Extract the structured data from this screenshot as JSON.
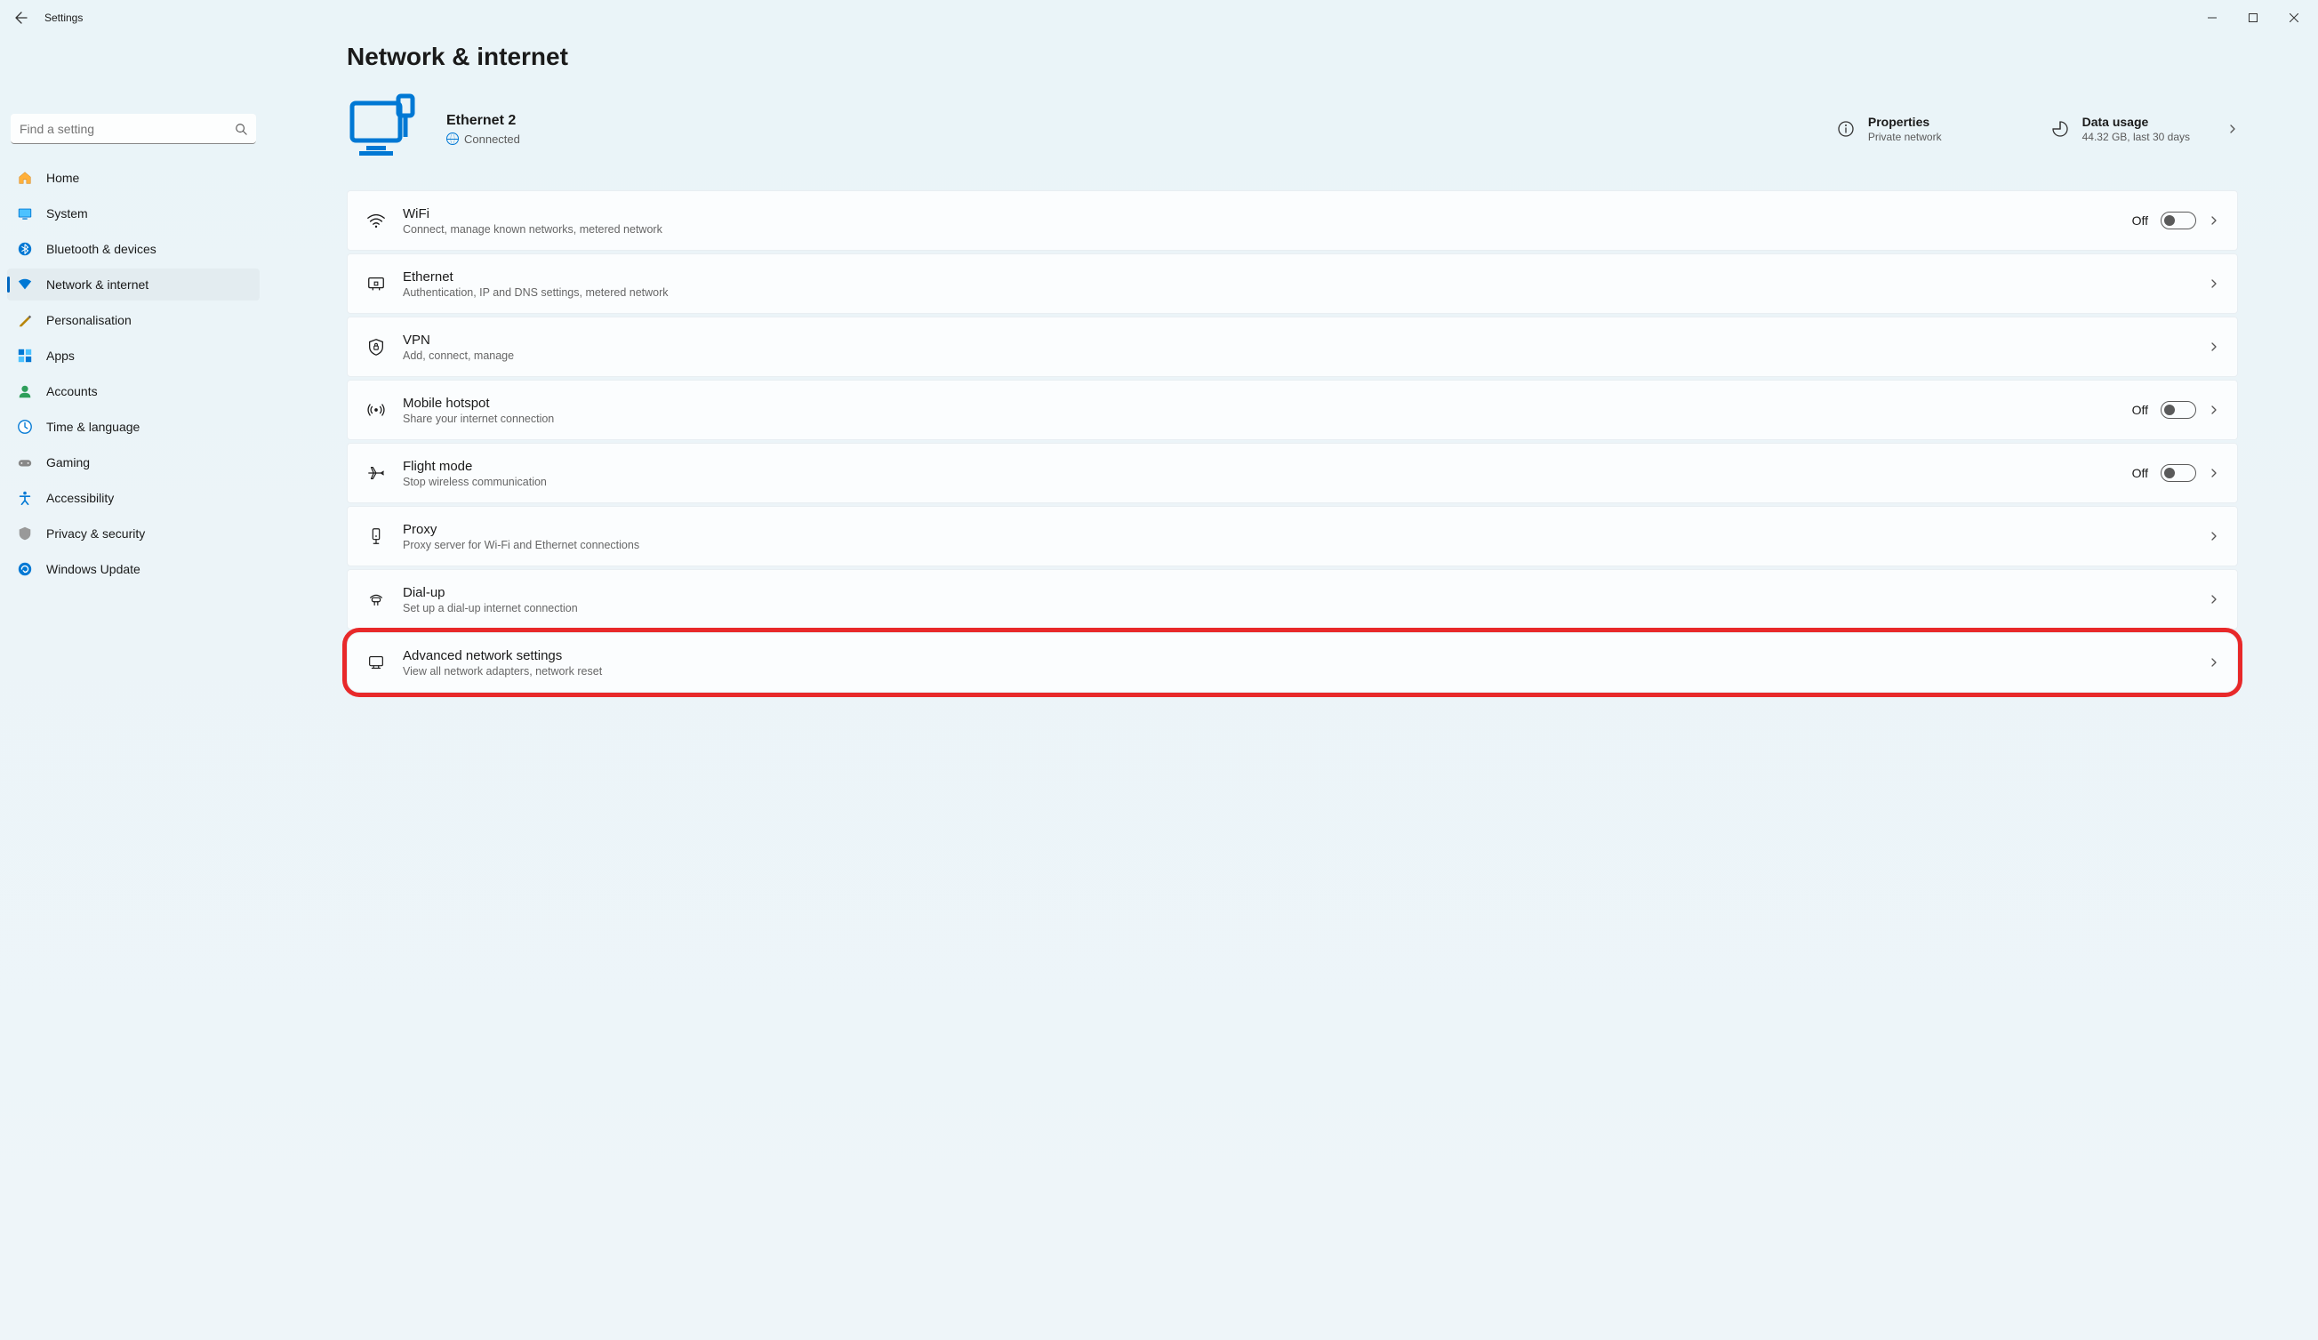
{
  "app": {
    "title": "Settings"
  },
  "search": {
    "placeholder": "Find a setting"
  },
  "sidebar": {
    "items": [
      {
        "label": "Home"
      },
      {
        "label": "System"
      },
      {
        "label": "Bluetooth & devices"
      },
      {
        "label": "Network & internet"
      },
      {
        "label": "Personalisation"
      },
      {
        "label": "Apps"
      },
      {
        "label": "Accounts"
      },
      {
        "label": "Time & language"
      },
      {
        "label": "Gaming"
      },
      {
        "label": "Accessibility"
      },
      {
        "label": "Privacy & security"
      },
      {
        "label": "Windows Update"
      }
    ]
  },
  "page": {
    "title": "Network & internet",
    "connection": {
      "name": "Ethernet 2",
      "status": "Connected"
    },
    "properties": {
      "title": "Properties",
      "subtitle": "Private network"
    },
    "usage": {
      "title": "Data usage",
      "subtitle": "44.32 GB, last 30 days"
    }
  },
  "rows": {
    "wifi": {
      "title": "WiFi",
      "subtitle": "Connect, manage known networks, metered network",
      "state": "Off"
    },
    "ethernet": {
      "title": "Ethernet",
      "subtitle": "Authentication, IP and DNS settings, metered network"
    },
    "vpn": {
      "title": "VPN",
      "subtitle": "Add, connect, manage"
    },
    "hotspot": {
      "title": "Mobile hotspot",
      "subtitle": "Share your internet connection",
      "state": "Off"
    },
    "flight": {
      "title": "Flight mode",
      "subtitle": "Stop wireless communication",
      "state": "Off"
    },
    "proxy": {
      "title": "Proxy",
      "subtitle": "Proxy server for Wi-Fi and Ethernet connections"
    },
    "dialup": {
      "title": "Dial-up",
      "subtitle": "Set up a dial-up internet connection"
    },
    "advanced": {
      "title": "Advanced network settings",
      "subtitle": "View all network adapters, network reset"
    }
  }
}
